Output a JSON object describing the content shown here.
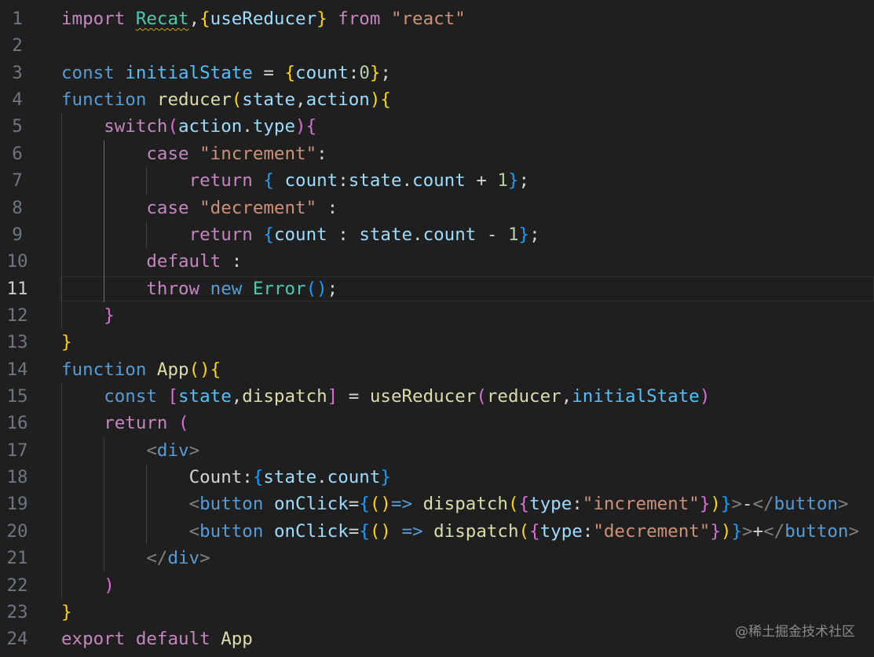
{
  "editor": {
    "lines": [
      {
        "n": "1",
        "tokens": [
          [
            "import",
            "#c586c0"
          ],
          [
            " ",
            "#d4d4d4"
          ],
          [
            "Recat",
            "#4ec9b0",
            "squiggle"
          ],
          [
            ",",
            "#d4d4d4"
          ],
          [
            "{",
            "#ffd700"
          ],
          [
            "useReducer",
            "#9cdcfe"
          ],
          [
            "}",
            "#ffd700"
          ],
          [
            " ",
            "#d4d4d4"
          ],
          [
            "from",
            "#c586c0"
          ],
          [
            " ",
            "#d4d4d4"
          ],
          [
            "\"react\"",
            "#ce9178"
          ]
        ]
      },
      {
        "n": "2",
        "tokens": []
      },
      {
        "n": "3",
        "tokens": [
          [
            "const",
            "#569cd6"
          ],
          [
            " ",
            "#d4d4d4"
          ],
          [
            "initialState",
            "#4fc1ff"
          ],
          [
            " = ",
            "#d4d4d4"
          ],
          [
            "{",
            "#ffd700"
          ],
          [
            "count",
            "#9cdcfe"
          ],
          [
            ":",
            "#d4d4d4"
          ],
          [
            "0",
            "#b5cea8"
          ],
          [
            "}",
            "#ffd700"
          ],
          [
            ";",
            "#d4d4d4"
          ]
        ]
      },
      {
        "n": "4",
        "tokens": [
          [
            "function",
            "#569cd6"
          ],
          [
            " ",
            "#d4d4d4"
          ],
          [
            "reducer",
            "#dcdcaa"
          ],
          [
            "(",
            "#ffd700"
          ],
          [
            "state",
            "#9cdcfe"
          ],
          [
            ",",
            "#d4d4d4"
          ],
          [
            "action",
            "#9cdcfe"
          ],
          [
            ")",
            "#ffd700"
          ],
          [
            "{",
            "#ffd700"
          ]
        ]
      },
      {
        "n": "5",
        "tokens": [
          [
            "    ",
            "#d4d4d4"
          ],
          [
            "switch",
            "#c586c0"
          ],
          [
            "(",
            "#da70d6"
          ],
          [
            "action",
            "#9cdcfe"
          ],
          [
            ".",
            "#d4d4d4"
          ],
          [
            "type",
            "#9cdcfe"
          ],
          [
            ")",
            "#da70d6"
          ],
          [
            "{",
            "#da70d6"
          ]
        ]
      },
      {
        "n": "6",
        "tokens": [
          [
            "        ",
            "#d4d4d4"
          ],
          [
            "case",
            "#c586c0"
          ],
          [
            " ",
            "#d4d4d4"
          ],
          [
            "\"increment\"",
            "#ce9178"
          ],
          [
            ":",
            "#d4d4d4"
          ]
        ]
      },
      {
        "n": "7",
        "tokens": [
          [
            "            ",
            "#d4d4d4"
          ],
          [
            "return",
            "#c586c0"
          ],
          [
            " ",
            "#d4d4d4"
          ],
          [
            "{",
            "#179fff"
          ],
          [
            " ",
            "#d4d4d4"
          ],
          [
            "count",
            "#9cdcfe"
          ],
          [
            ":",
            "#d4d4d4"
          ],
          [
            "state",
            "#9cdcfe"
          ],
          [
            ".",
            "#d4d4d4"
          ],
          [
            "count",
            "#9cdcfe"
          ],
          [
            " + ",
            "#d4d4d4"
          ],
          [
            "1",
            "#b5cea8"
          ],
          [
            "}",
            "#179fff"
          ],
          [
            ";",
            "#d4d4d4"
          ]
        ]
      },
      {
        "n": "8",
        "tokens": [
          [
            "        ",
            "#d4d4d4"
          ],
          [
            "case",
            "#c586c0"
          ],
          [
            " ",
            "#d4d4d4"
          ],
          [
            "\"decrement\"",
            "#ce9178"
          ],
          [
            " :",
            "#d4d4d4"
          ]
        ]
      },
      {
        "n": "9",
        "tokens": [
          [
            "            ",
            "#d4d4d4"
          ],
          [
            "return",
            "#c586c0"
          ],
          [
            " ",
            "#d4d4d4"
          ],
          [
            "{",
            "#179fff"
          ],
          [
            "count",
            "#9cdcfe"
          ],
          [
            " : ",
            "#d4d4d4"
          ],
          [
            "state",
            "#9cdcfe"
          ],
          [
            ".",
            "#d4d4d4"
          ],
          [
            "count",
            "#9cdcfe"
          ],
          [
            " - ",
            "#d4d4d4"
          ],
          [
            "1",
            "#b5cea8"
          ],
          [
            "}",
            "#179fff"
          ],
          [
            ";",
            "#d4d4d4"
          ]
        ]
      },
      {
        "n": "10",
        "tokens": [
          [
            "        ",
            "#d4d4d4"
          ],
          [
            "default",
            "#c586c0"
          ],
          [
            " :",
            "#d4d4d4"
          ]
        ]
      },
      {
        "n": "11",
        "current": true,
        "tokens": [
          [
            "        ",
            "#d4d4d4"
          ],
          [
            "throw",
            "#c586c0"
          ],
          [
            " ",
            "#d4d4d4"
          ],
          [
            "new",
            "#569cd6"
          ],
          [
            " ",
            "#d4d4d4"
          ],
          [
            "Error",
            "#4ec9b0"
          ],
          [
            "(",
            "#179fff"
          ],
          [
            ")",
            "#179fff"
          ],
          [
            ";",
            "#d4d4d4"
          ]
        ]
      },
      {
        "n": "12",
        "tokens": [
          [
            "    ",
            "#d4d4d4"
          ],
          [
            "}",
            "#da70d6"
          ]
        ]
      },
      {
        "n": "13",
        "tokens": [
          [
            "}",
            "#ffd700"
          ]
        ]
      },
      {
        "n": "14",
        "tokens": [
          [
            "function",
            "#569cd6"
          ],
          [
            " ",
            "#d4d4d4"
          ],
          [
            "App",
            "#dcdcaa"
          ],
          [
            "(",
            "#ffd700"
          ],
          [
            ")",
            "#ffd700"
          ],
          [
            "{",
            "#ffd700"
          ]
        ]
      },
      {
        "n": "15",
        "tokens": [
          [
            "    ",
            "#d4d4d4"
          ],
          [
            "const",
            "#569cd6"
          ],
          [
            " ",
            "#d4d4d4"
          ],
          [
            "[",
            "#da70d6"
          ],
          [
            "state",
            "#4fc1ff"
          ],
          [
            ",",
            "#d4d4d4"
          ],
          [
            "dispatch",
            "#dcdcaa"
          ],
          [
            "]",
            "#da70d6"
          ],
          [
            " = ",
            "#d4d4d4"
          ],
          [
            "useReducer",
            "#dcdcaa"
          ],
          [
            "(",
            "#da70d6"
          ],
          [
            "reducer",
            "#dcdcaa"
          ],
          [
            ",",
            "#d4d4d4"
          ],
          [
            "initialState",
            "#4fc1ff"
          ],
          [
            ")",
            "#da70d6"
          ]
        ]
      },
      {
        "n": "16",
        "tokens": [
          [
            "    ",
            "#d4d4d4"
          ],
          [
            "return",
            "#c586c0"
          ],
          [
            " ",
            "#d4d4d4"
          ],
          [
            "(",
            "#da70d6"
          ]
        ]
      },
      {
        "n": "17",
        "tokens": [
          [
            "        ",
            "#d4d4d4"
          ],
          [
            "<",
            "#808080"
          ],
          [
            "div",
            "#569cd6"
          ],
          [
            ">",
            "#808080"
          ]
        ]
      },
      {
        "n": "18",
        "tokens": [
          [
            "            ",
            "#d4d4d4"
          ],
          [
            "Count:",
            "#d4d4d4"
          ],
          [
            "{",
            "#179fff"
          ],
          [
            "state",
            "#9cdcfe"
          ],
          [
            ".",
            "#d4d4d4"
          ],
          [
            "count",
            "#9cdcfe"
          ],
          [
            "}",
            "#179fff"
          ]
        ]
      },
      {
        "n": "19",
        "tokens": [
          [
            "            ",
            "#d4d4d4"
          ],
          [
            "<",
            "#808080"
          ],
          [
            "button",
            "#569cd6"
          ],
          [
            " ",
            "#d4d4d4"
          ],
          [
            "onClick",
            "#9cdcfe"
          ],
          [
            "=",
            "#d4d4d4"
          ],
          [
            "{",
            "#179fff"
          ],
          [
            "()",
            "#ffd700"
          ],
          [
            "=>",
            "#569cd6"
          ],
          [
            " ",
            "#d4d4d4"
          ],
          [
            "dispatch",
            "#dcdcaa"
          ],
          [
            "(",
            "#ffd700"
          ],
          [
            "{",
            "#da70d6"
          ],
          [
            "type",
            "#9cdcfe"
          ],
          [
            ":",
            "#d4d4d4"
          ],
          [
            "\"increment\"",
            "#ce9178"
          ],
          [
            "}",
            "#da70d6"
          ],
          [
            ")",
            "#ffd700"
          ],
          [
            "}",
            "#179fff"
          ],
          [
            ">",
            "#808080"
          ],
          [
            "-",
            "#d4d4d4"
          ],
          [
            "</",
            "#808080"
          ],
          [
            "button",
            "#569cd6"
          ],
          [
            ">",
            "#808080"
          ]
        ]
      },
      {
        "n": "20",
        "tokens": [
          [
            "            ",
            "#d4d4d4"
          ],
          [
            "<",
            "#808080"
          ],
          [
            "button",
            "#569cd6"
          ],
          [
            " ",
            "#d4d4d4"
          ],
          [
            "onClick",
            "#9cdcfe"
          ],
          [
            "=",
            "#d4d4d4"
          ],
          [
            "{",
            "#179fff"
          ],
          [
            "()",
            "#ffd700"
          ],
          [
            " ",
            "#d4d4d4"
          ],
          [
            "=>",
            "#569cd6"
          ],
          [
            " ",
            "#d4d4d4"
          ],
          [
            "dispatch",
            "#dcdcaa"
          ],
          [
            "(",
            "#ffd700"
          ],
          [
            "{",
            "#da70d6"
          ],
          [
            "type",
            "#9cdcfe"
          ],
          [
            ":",
            "#d4d4d4"
          ],
          [
            "\"decrement\"",
            "#ce9178"
          ],
          [
            "}",
            "#da70d6"
          ],
          [
            ")",
            "#ffd700"
          ],
          [
            "}",
            "#179fff"
          ],
          [
            ">",
            "#808080"
          ],
          [
            "+",
            "#d4d4d4"
          ],
          [
            "</",
            "#808080"
          ],
          [
            "button",
            "#569cd6"
          ],
          [
            ">",
            "#808080"
          ]
        ]
      },
      {
        "n": "21",
        "tokens": [
          [
            "        ",
            "#d4d4d4"
          ],
          [
            "</",
            "#808080"
          ],
          [
            "div",
            "#569cd6"
          ],
          [
            ">",
            "#808080"
          ]
        ]
      },
      {
        "n": "22",
        "tokens": [
          [
            "    ",
            "#d4d4d4"
          ],
          [
            ")",
            "#da70d6"
          ]
        ]
      },
      {
        "n": "23",
        "tokens": [
          [
            "}",
            "#ffd700"
          ]
        ]
      },
      {
        "n": "24",
        "tokens": [
          [
            "export",
            "#c586c0"
          ],
          [
            " ",
            "#d4d4d4"
          ],
          [
            "default",
            "#c586c0"
          ],
          [
            " ",
            "#d4d4d4"
          ],
          [
            "App",
            "#dcdcaa"
          ]
        ]
      }
    ]
  },
  "watermark": "@稀土掘金技术社区"
}
